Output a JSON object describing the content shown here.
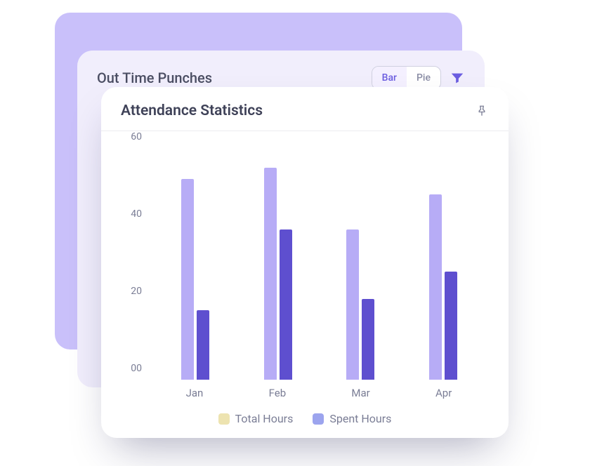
{
  "mid_card": {
    "title": "Out Time Punches",
    "seg_bar": "Bar",
    "seg_pie": "Pie"
  },
  "front_card": {
    "title": "Attendance Statistics"
  },
  "legend": {
    "total": "Total Hours",
    "spent": "Spent Hours"
  },
  "chart_data": {
    "type": "bar",
    "title": "Attendance Statistics",
    "xlabel": "",
    "ylabel": "",
    "categories": [
      "Jan",
      "Feb",
      "Mar",
      "Apr"
    ],
    "series": [
      {
        "name": "Total Hours",
        "values": [
          52,
          55,
          39,
          48
        ]
      },
      {
        "name": "Spent Hours",
        "values": [
          18,
          39,
          21,
          28
        ]
      }
    ],
    "ylim": [
      0,
      60
    ],
    "yticks": [
      "00",
      "20",
      "40",
      "60"
    ]
  }
}
